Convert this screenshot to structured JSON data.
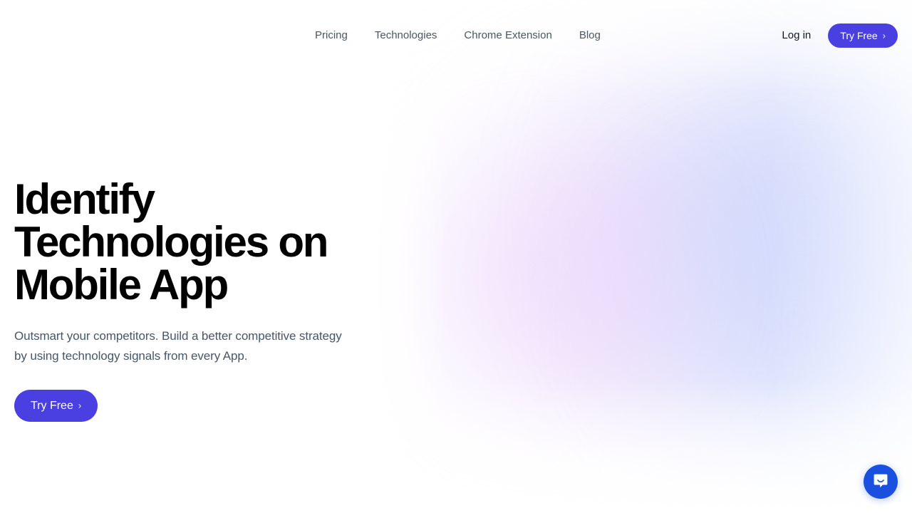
{
  "theme": {
    "background": "#ffffff",
    "accent_purple": "#4a3fe0",
    "chat_blue": "#1a50e0",
    "nav_text": "#4b5563",
    "heading_text": "#000000",
    "body_text": "#48566a",
    "gradient_pink": "#ebddfb",
    "gradient_blue": "#cfd6fa"
  },
  "header": {
    "nav_links": [
      {
        "label": "Pricing"
      },
      {
        "label": "Technologies"
      },
      {
        "label": "Chrome Extension"
      },
      {
        "label": "Blog"
      }
    ],
    "login_label": "Log in",
    "cta_label": "Try Free",
    "cta_chevron": "›"
  },
  "hero": {
    "title": "Identify Technologies on Mobile App",
    "subtitle": "Outsmart your competitors. Build a better competitive strategy by using technology signals from every App.",
    "cta_label": "Try Free",
    "cta_chevron": "›"
  },
  "chat": {
    "icon": "chat-bubble-smile-icon",
    "aria_label": "Open Intercom Messenger"
  }
}
